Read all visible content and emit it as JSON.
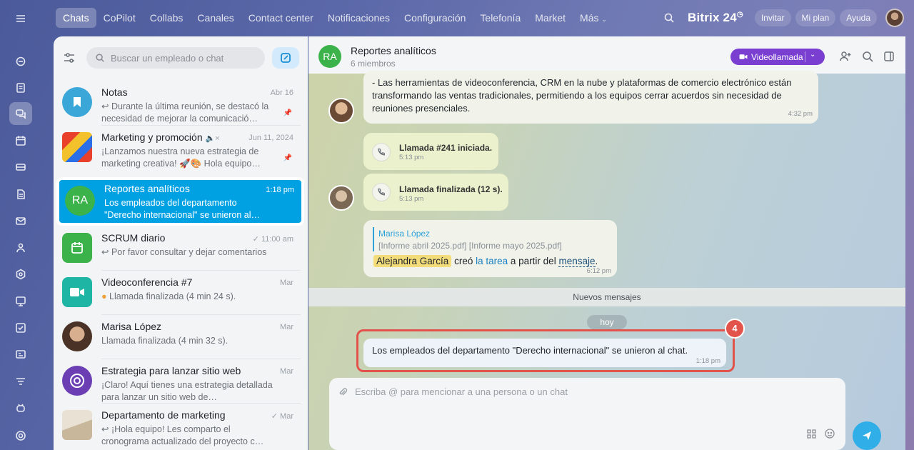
{
  "topnav": {
    "tabs": [
      "Chats",
      "CoPilot",
      "Collabs",
      "Canales",
      "Contact center",
      "Notificaciones",
      "Configuración",
      "Telefonía",
      "Market",
      "Más"
    ],
    "brand": "Bitrix 24",
    "invite": "Invitar",
    "plan": "Mi plan",
    "help": "Ayuda"
  },
  "sidebar": {
    "search_placeholder": "Buscar un empleado o chat",
    "chats": [
      {
        "title": "Notas",
        "date": "Abr 16",
        "message": "↩ Durante la última reunión, se destacó la necesidad de mejorar la comunicació…"
      },
      {
        "title": "Marketing y promoción",
        "date": "Jun 11, 2024",
        "message": "¡Lanzamos nuestra nueva estrategia de marketing creativa! 🚀🎨 Hola equipo…"
      },
      {
        "title": "Reportes analíticos",
        "initials": "RA",
        "date": "1:18 pm",
        "message": "Los empleados del departamento \"Derecho internacional\" se unieron al…"
      },
      {
        "title": "SCRUM diario",
        "date": "11:00 am",
        "message": "↩ Por favor consultar y dejar comentarios"
      },
      {
        "title": "Videoconferencia #7",
        "date": "Mar",
        "message": "Llamada finalizada (4 min 24 s)."
      },
      {
        "title": "Marisa López",
        "date": "Mar",
        "message": "Llamada finalizada (4 min 32 s)."
      },
      {
        "title": "Estrategia para lanzar sitio web",
        "date": "Mar",
        "message": "¡Claro! Aquí tienes una estrategia detallada para lanzar un sitio web de…"
      },
      {
        "title": "Departamento de marketing",
        "date": "Mar",
        "message": "↩ ¡Hola equipo! Les comparto el cronograma actualizado del proyecto c…"
      }
    ]
  },
  "chat": {
    "initials": "RA",
    "title": "Reportes analíticos",
    "subtitle": "6 miembros",
    "video_button": "Videollamada",
    "messages": {
      "m1_text": "- Las herramientas de videoconferencia, CRM en la nube y plataformas de comercio electrónico están transformando las ventas tradicionales, permitiendo a los equipos cerrar acuerdos sin necesidad de reuniones presenciales.",
      "m1_time": "4:32 pm",
      "call1_text": "Llamada #241 iniciada.",
      "call1_time": "5:13 pm",
      "call2_text": "Llamada finalizada (12 s).",
      "call2_time": "5:13 pm",
      "quote_author": "Marisa López",
      "quote_files": "[Informe abril 2025.pdf] [Informe mayo 2025.pdf]",
      "task_user": "Alejandra García",
      "task_created": "creó",
      "task_link": "la tarea",
      "task_from": "a partir del",
      "task_msg": "mensaje",
      "task_end": ".",
      "task_time": "6:12 pm",
      "new_messages": "Nuevos mensajes",
      "today": "hoy",
      "system_text": "Los empleados del departamento \"Derecho internacional\" se unieron al chat.",
      "system_time": "1:18 pm",
      "step_badge": "4"
    },
    "input_placeholder": "Escriba @ para mencionar a una persona o un chat"
  },
  "colors": {
    "accent": "#00a1e3",
    "video": "#7a3fd1",
    "highlight": "#e2534b"
  }
}
